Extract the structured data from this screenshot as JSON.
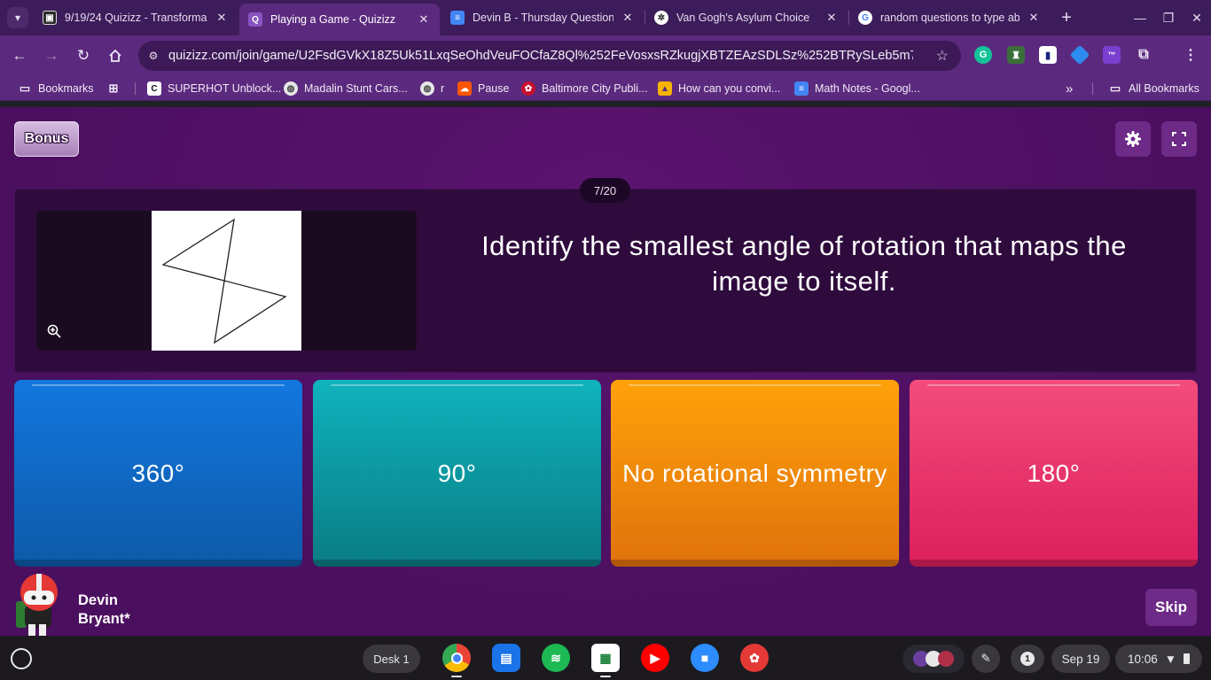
{
  "tabs": [
    {
      "title": "9/19/24 Quizizz - Transforma",
      "active": false,
      "favicon_color": "#ffffff"
    },
    {
      "title": "Playing a Game - Quizizz",
      "active": true,
      "favicon_color": "#8854c0"
    },
    {
      "title": "Devin B - Thursday Question A",
      "active": false,
      "favicon_color": "#4285f4"
    },
    {
      "title": "Van Gogh's Asylum Choice",
      "active": false,
      "favicon_color": "#ffffff"
    },
    {
      "title": "random questions to type ab",
      "active": false,
      "favicon_color": "#ffffff"
    }
  ],
  "omnibox": {
    "url": "quizizz.com/join/game/U2FsdGVkX18Z5Uk51LxqSeOhdVeuFOCfaZ8Ql%252FeVosxsRZkugjXBTZEAzSDLSz%252BTRySLeb5m7%252..."
  },
  "bookmarks": {
    "root_label": "Bookmarks",
    "items": [
      {
        "label": "SUPERHOT Unblock...",
        "icon": "superhot-icon"
      },
      {
        "label": "Madalin Stunt Cars...",
        "icon": "globe-icon"
      },
      {
        "label": "r",
        "icon": "globe-icon"
      },
      {
        "label": "Pause",
        "icon": "soundcloud-icon"
      },
      {
        "label": "Baltimore City Publi...",
        "icon": "bcps-icon"
      },
      {
        "label": "How can you convi...",
        "icon": "image-icon"
      },
      {
        "label": "Math Notes - Googl...",
        "icon": "docs-icon"
      }
    ],
    "all_label": "All Bookmarks"
  },
  "game": {
    "bonus_label": "Bonus",
    "counter": "7/20",
    "question": "Identify the smallest angle of rotation that maps the image to itself.",
    "answers": [
      {
        "label": "360°",
        "color": "#1377df"
      },
      {
        "label": "90°",
        "color": "#10b3be"
      },
      {
        "label": "No rotational symmetry",
        "color": "#ffa20a"
      },
      {
        "label": "180°",
        "color": "#f34c7d"
      }
    ],
    "player": {
      "first": "Devin",
      "last": "Bryant*"
    },
    "skip_label": "Skip"
  },
  "shelf": {
    "desk_label": "Desk 1",
    "notifications": "1",
    "date": "Sep 19",
    "time": "10:06"
  }
}
